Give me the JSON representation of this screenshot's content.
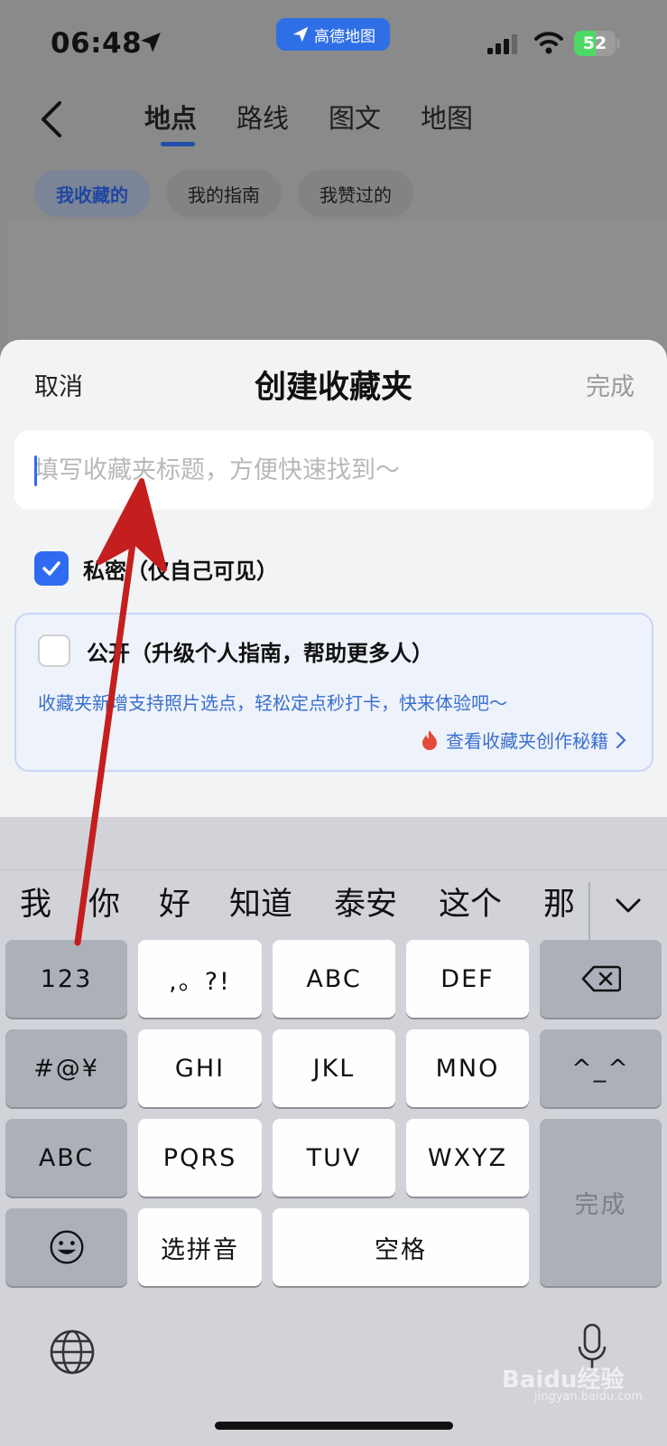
{
  "status_bar": {
    "time": "06:48",
    "app_pill": "高德地图",
    "battery_percent": 52,
    "battery_label": "52"
  },
  "header": {
    "tabs": [
      {
        "label": "地点",
        "active": true
      },
      {
        "label": "路线",
        "active": false
      },
      {
        "label": "图文",
        "active": false
      },
      {
        "label": "地图",
        "active": false
      }
    ],
    "chips": [
      {
        "label": "我收藏的",
        "active": true
      },
      {
        "label": "我的指南",
        "active": false
      },
      {
        "label": "我赞过的",
        "active": false
      }
    ]
  },
  "sheet": {
    "cancel_label": "取消",
    "title": "创建收藏夹",
    "done_label": "完成",
    "title_input": {
      "value": "",
      "placeholder": "填写收藏夹标题，方便快速找到～"
    },
    "private_option": {
      "label": "私密（仅自己可见）",
      "checked": true
    },
    "public_option": {
      "label": "公开（升级个人指南，帮助更多人）",
      "checked": false,
      "description": "收藏夹新增支持照片选点，轻松定点秒打卡，快来体验吧～",
      "link_label": "查看收藏夹创作秘籍"
    }
  },
  "keyboard": {
    "suggestions": [
      "我",
      "你",
      "好",
      "知道",
      "泰安",
      "这个",
      "那"
    ],
    "keys": {
      "num": "123",
      "punct": ",。?!",
      "abc1": "ABC",
      "def": "DEF",
      "symbols": "#@¥",
      "ghi": "GHI",
      "jkl": "JKL",
      "mno": "MNO",
      "emoticon": "^_^",
      "abc_mode": "ABC",
      "pqrs": "PQRS",
      "tuv": "TUV",
      "wxyz": "WXYZ",
      "done": "完成",
      "pinyin": "选拼音",
      "space": "空格"
    }
  },
  "watermark": {
    "text": "Baidu经验",
    "sub": "jingyan.baidu.com"
  },
  "colors": {
    "accent": "#2e6bf0",
    "link": "#3a6fcf",
    "annotation_arrow": "#c41e1e",
    "app_pill": "#2f6fe6"
  }
}
